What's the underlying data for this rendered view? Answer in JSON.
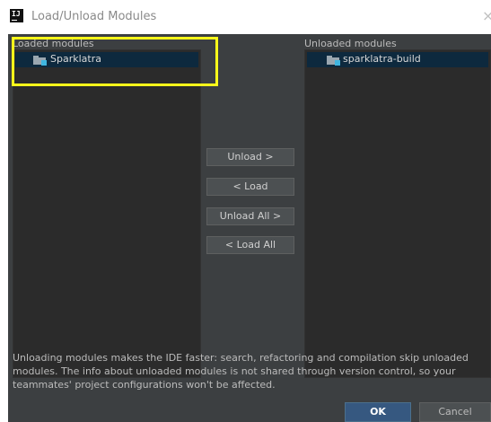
{
  "window": {
    "title": "Load/Unload Modules",
    "app_icon_text": "IJ",
    "close_glyph": "×"
  },
  "loaded": {
    "header": "Loaded modules",
    "items": [
      {
        "label": "Sparklatra",
        "icon": "module-folder-icon"
      }
    ]
  },
  "unloaded": {
    "header": "Unloaded modules",
    "items": [
      {
        "label": "sparklatra-build",
        "icon": "module-folder-icon"
      }
    ]
  },
  "actions": {
    "unload": "Unload >",
    "load": "< Load",
    "unload_all": "Unload All >",
    "load_all": "< Load All"
  },
  "info": "Unloading modules makes the IDE faster: search, refactoring and compilation skip unloaded modules. The info about unloaded modules is not shared through version control, so your teammates' project configurations won't be affected.",
  "footer": {
    "ok": "OK",
    "cancel": "Cancel"
  },
  "colors": {
    "dialog_bg": "#3c3f41",
    "list_bg": "#2b2b2b",
    "selection": "#0d293e",
    "primary_button": "#365880",
    "annotation_highlight": "#ffff1a"
  }
}
